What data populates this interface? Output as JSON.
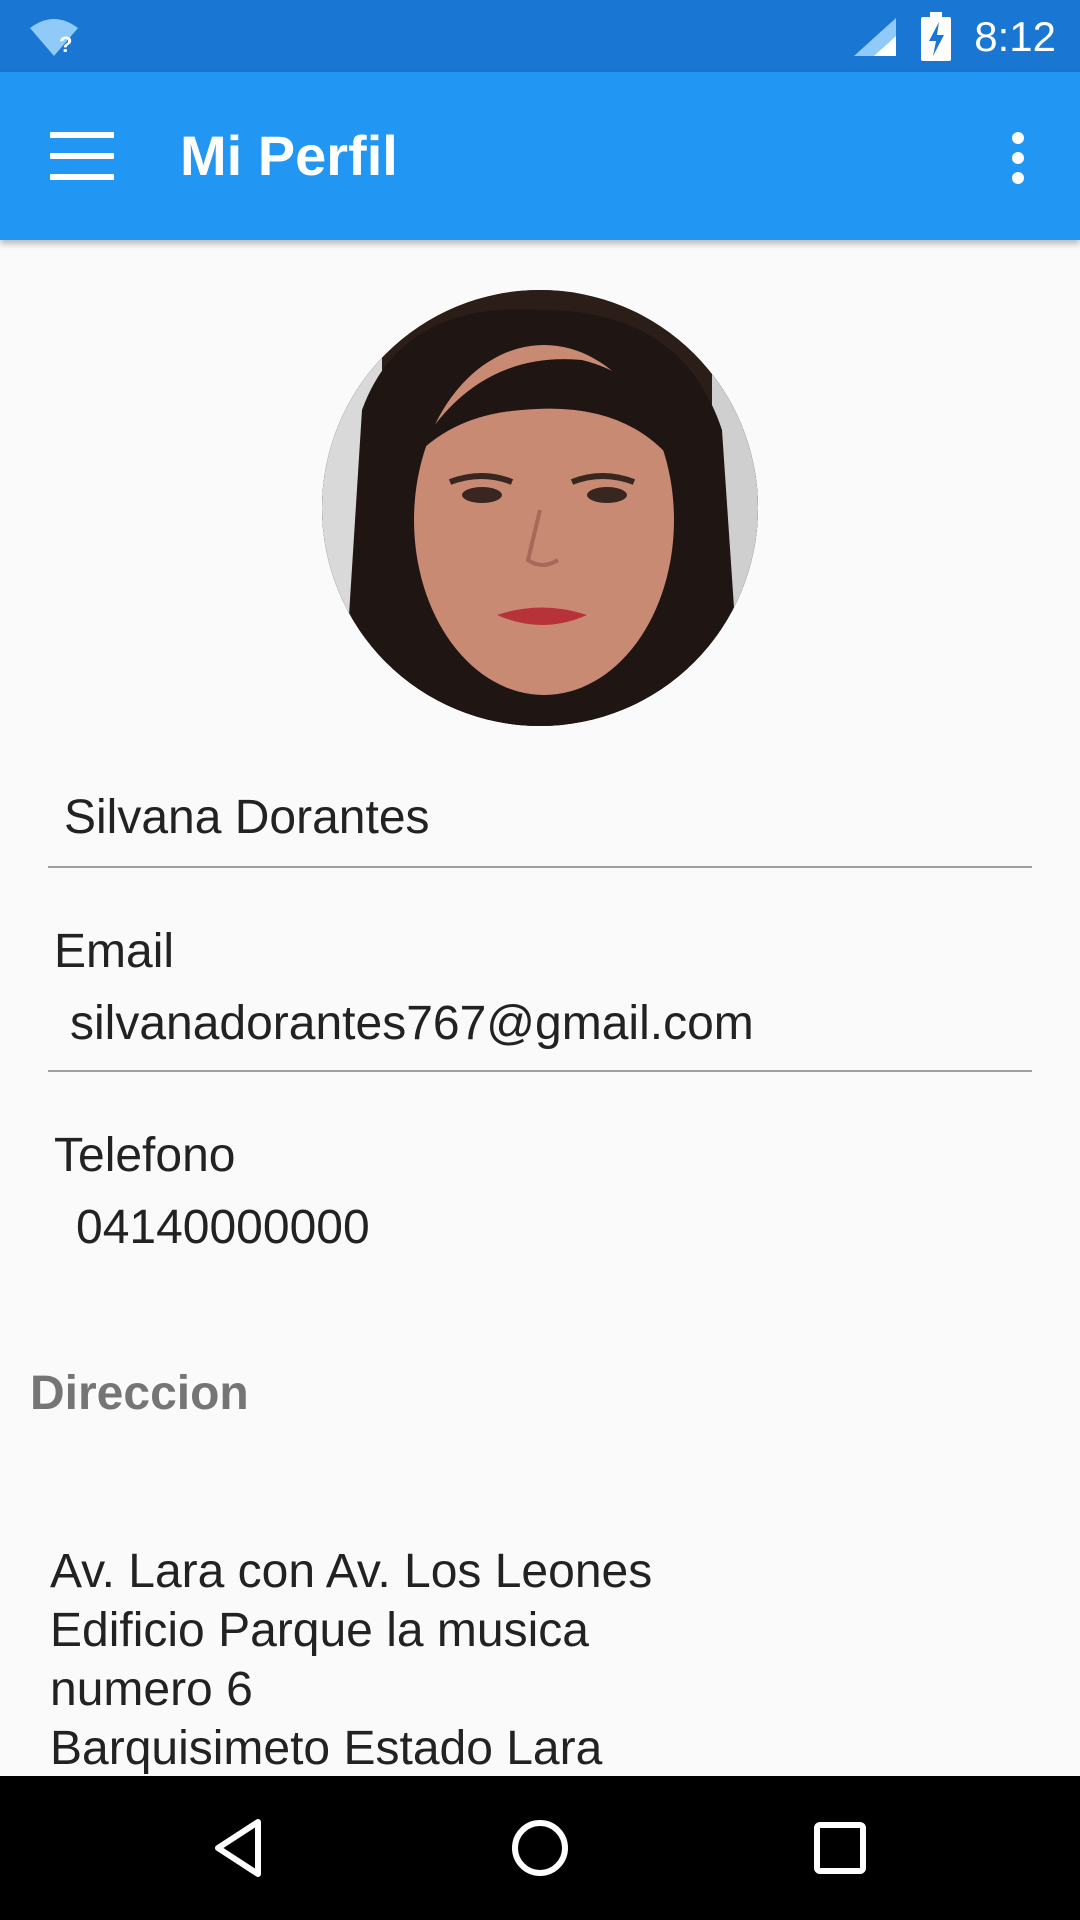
{
  "status_bar": {
    "time": "8:12",
    "icons": [
      "wifi-question-icon",
      "signal-icon",
      "battery-charging-icon"
    ]
  },
  "app_bar": {
    "title": "Mi Perfil",
    "icons": [
      "menu-icon",
      "overflow-menu-icon"
    ],
    "color": "#2196f3",
    "status_color": "#1976d2"
  },
  "profile": {
    "avatar": "profile-photo",
    "name": "Silvana Dorantes",
    "email_label": "Email",
    "email": "silvanadorantes767@gmail.com",
    "phone_label": "Telefono",
    "phone": "04140000000"
  },
  "address": {
    "title": "Direccion",
    "lines": [
      "Av. Lara con Av. Los Leones",
      "Edificio Parque la musica",
      "numero 6",
      "Barquisimeto Estado Lara"
    ]
  },
  "nav_bar": {
    "icons": [
      "back-icon",
      "home-icon",
      "recents-icon"
    ]
  }
}
